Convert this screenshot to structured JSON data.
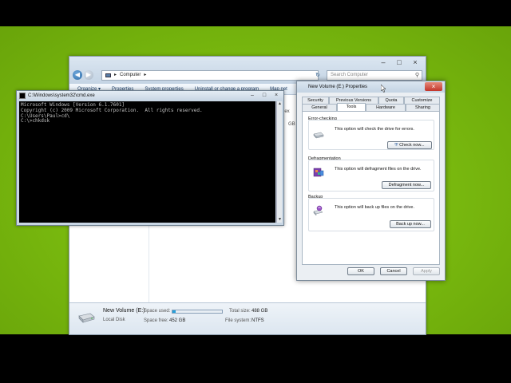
{
  "explorer": {
    "address": "Computer",
    "search_placeholder": "Search Computer",
    "toolbar": [
      "Organize ▾",
      "Properties",
      "System properties",
      "Uninstall or change a program",
      "Map net"
    ],
    "content_fragments": [
      "Nex",
      "GB"
    ],
    "details": {
      "name": "New Volume (E:)",
      "type": "Local Disk",
      "space_used_label": "Space used:",
      "space_used_fraction": 0.06,
      "space_free_label": "Space free:",
      "space_free": "452 GB",
      "total_size_label": "Total size:",
      "total_size": "488 GB",
      "file_system_label": "File system:",
      "file_system": "NTFS"
    }
  },
  "cmd": {
    "title": "C:\\Windows\\system32\\cmd.exe",
    "lines": [
      "Microsoft Windows [Version 6.1.7601]",
      "Copyright (c) 2009 Microsoft Corporation.  All rights reserved.",
      "",
      "C:\\Users\\Paul>cd\\",
      "",
      "C:\\>chkdsk"
    ]
  },
  "properties": {
    "title": "New Volume (E:) Properties",
    "tabs_row1": [
      "Security",
      "Previous Versions",
      "Quota",
      "Customize"
    ],
    "tabs_row2": [
      "General",
      "Tools",
      "Hardware",
      "Sharing"
    ],
    "active_tab": "Tools",
    "error_checking": {
      "title": "Error-checking",
      "text": "This option will check the drive for errors.",
      "button": "Check now..."
    },
    "defragmentation": {
      "title": "Defragmentation",
      "text": "This option will defragment files on the drive.",
      "button": "Defragment now..."
    },
    "backup": {
      "title": "Backup",
      "text": "This option will back up files on the drive.",
      "button": "Back up now..."
    },
    "buttons": {
      "ok": "OK",
      "cancel": "Cancel",
      "apply": "Apply"
    }
  },
  "colors": {
    "desktop": "#78b80e",
    "progress": "#26a0da",
    "close_button": "#c2352a"
  }
}
